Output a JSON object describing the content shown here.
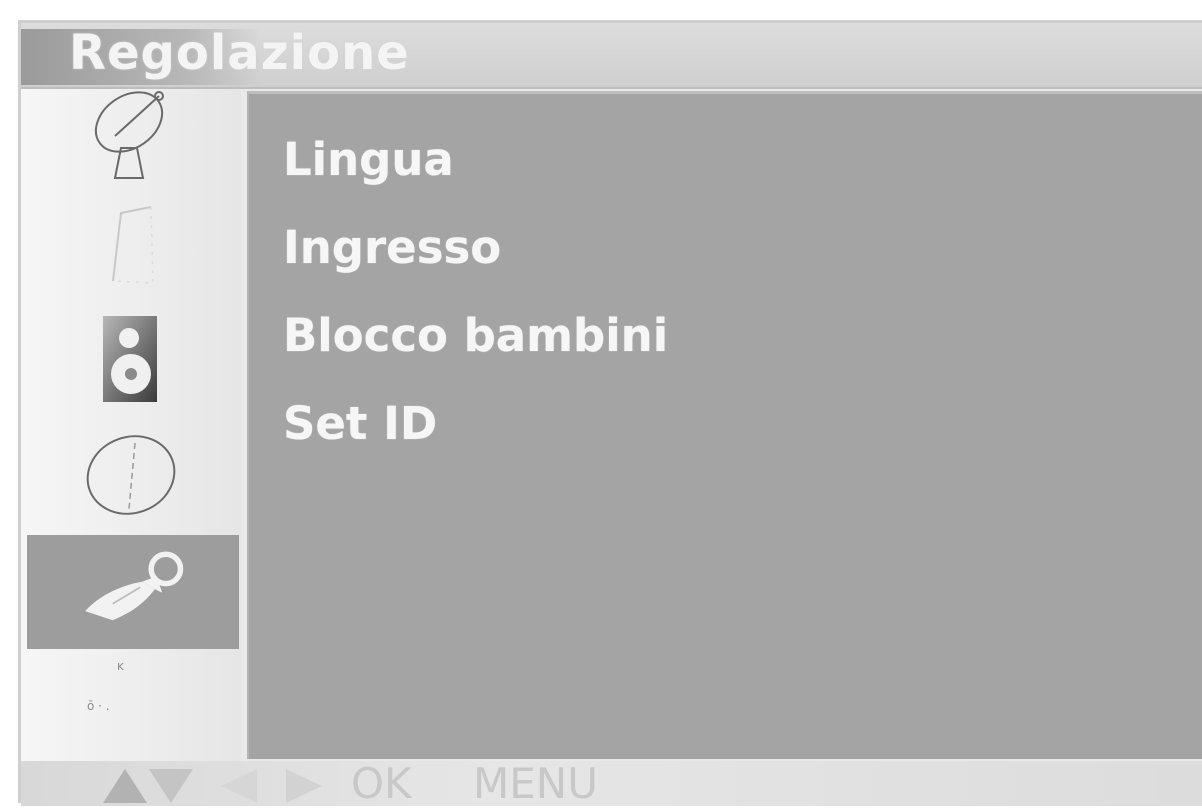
{
  "header": {
    "title": "Regolazione"
  },
  "sidebar": {
    "icons": [
      {
        "name": "satellite-dish-icon"
      },
      {
        "name": "picture-icon"
      },
      {
        "name": "sound-icon"
      },
      {
        "name": "time-icon"
      },
      {
        "name": "setup-wrench-icon",
        "selected": true
      }
    ]
  },
  "menu": {
    "items": [
      {
        "label": "Lingua"
      },
      {
        "label": "Ingresso"
      },
      {
        "label": "Blocco bambini"
      },
      {
        "label": "Set ID"
      }
    ]
  },
  "footer": {
    "ok_label": "OK",
    "menu_label": "MENU"
  },
  "colors": {
    "panel": "#a4a4a4",
    "selected": "#9d9d9d",
    "text": "#f6f6f6"
  }
}
